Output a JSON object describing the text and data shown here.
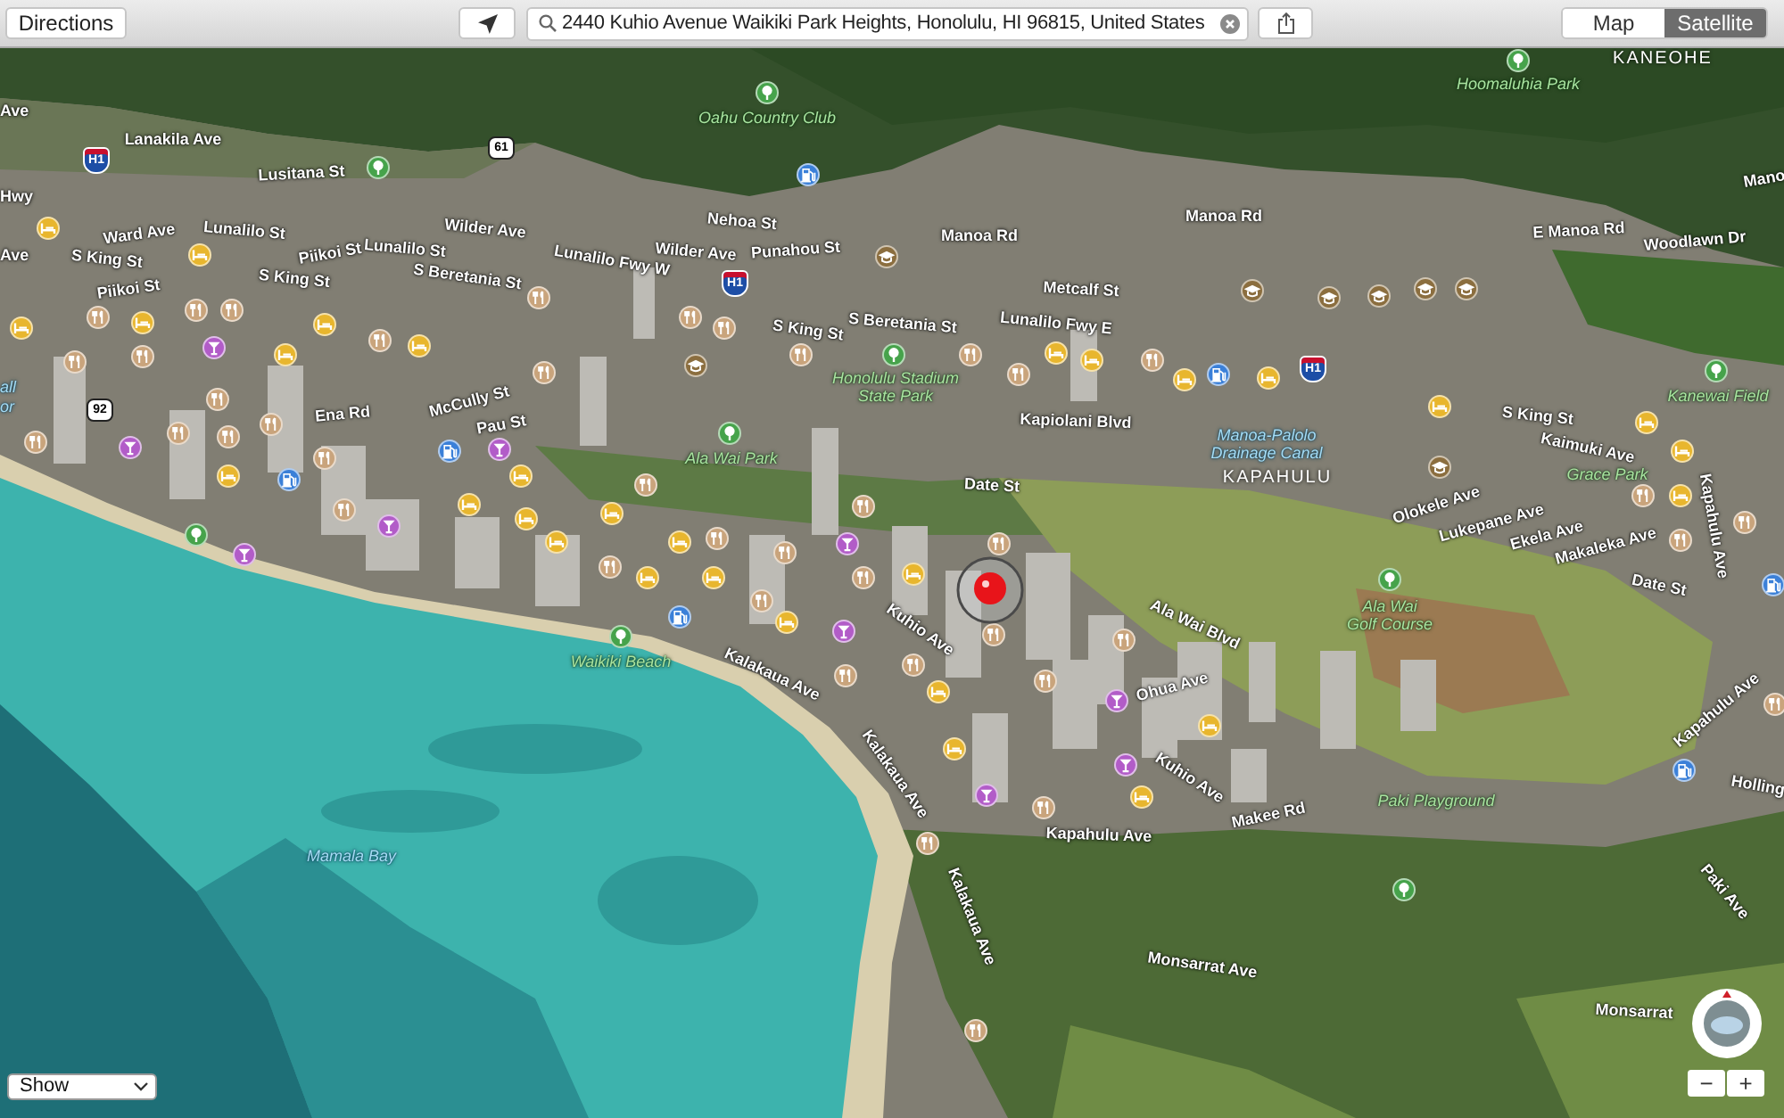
{
  "toolbar": {
    "directions_button": "Directions",
    "search": {
      "value": "2440 Kuhio Avenue Waikiki Park Heights, Honolulu, HI 96815, United States"
    },
    "view_modes": [
      {
        "label": "Map",
        "selected": false
      },
      {
        "label": "Satellite",
        "selected": true
      }
    ]
  },
  "map": {
    "labels": [
      {
        "kind": "district",
        "text": "KANEOHE"
      },
      {
        "kind": "park",
        "text": "Hoomaluhia Park"
      },
      {
        "kind": "street",
        "text": "Ave"
      },
      {
        "kind": "park",
        "text": "Oahu Country Club"
      },
      {
        "kind": "street",
        "text": "Lanakila Ave"
      },
      {
        "kind": "street",
        "text": "Lusitana St"
      },
      {
        "kind": "street",
        "text": "Mano"
      },
      {
        "kind": "street",
        "text": "Hwy"
      },
      {
        "kind": "street",
        "text": "Manoa Rd"
      },
      {
        "kind": "street",
        "text": "Nehoa St"
      },
      {
        "kind": "street",
        "text": "Ward Ave"
      },
      {
        "kind": "street",
        "text": "Lunalilo St"
      },
      {
        "kind": "street",
        "text": "Wilder Ave"
      },
      {
        "kind": "street",
        "text": "E Manoa Rd"
      },
      {
        "kind": "street",
        "text": "Manoa Rd"
      },
      {
        "kind": "street",
        "text": "Woodlawn Dr"
      },
      {
        "kind": "street",
        "text": "Lunalilo St"
      },
      {
        "kind": "street",
        "text": "Punahou St"
      },
      {
        "kind": "street",
        "text": "Wilder Ave"
      },
      {
        "kind": "street",
        "text": "Ave"
      },
      {
        "kind": "street",
        "text": "Piikoi St"
      },
      {
        "kind": "street",
        "text": "S King St"
      },
      {
        "kind": "street",
        "text": "Lunalilo Fwy W"
      },
      {
        "kind": "street",
        "text": "S King St"
      },
      {
        "kind": "street",
        "text": "S Beretania St"
      },
      {
        "kind": "street",
        "text": "Metcalf St"
      },
      {
        "kind": "street",
        "text": "Piikoi St"
      },
      {
        "kind": "street",
        "text": "S King St"
      },
      {
        "kind": "street",
        "text": "S Beretania St"
      },
      {
        "kind": "street",
        "text": "Lunalilo Fwy E"
      },
      {
        "kind": "water",
        "text": "all"
      },
      {
        "kind": "water",
        "text": "or"
      },
      {
        "kind": "street",
        "text": "Ena Rd"
      },
      {
        "kind": "street",
        "text": "McCully St"
      },
      {
        "kind": "street",
        "text": "Pau St"
      },
      {
        "kind": "park",
        "text": "Honolulu Stadium\nState Park"
      },
      {
        "kind": "street",
        "text": "Kapiolani Blvd"
      },
      {
        "kind": "street",
        "text": "S King St"
      },
      {
        "kind": "park",
        "text": "Kanewai Field"
      },
      {
        "kind": "park",
        "text": "Ala Wai Park"
      },
      {
        "kind": "water",
        "text": "Manoa-Palolo\nDrainage Canal"
      },
      {
        "kind": "street",
        "text": "Kaimuki Ave"
      },
      {
        "kind": "street",
        "text": "Date St"
      },
      {
        "kind": "district",
        "text": "KAPAHULU"
      },
      {
        "kind": "park",
        "text": "Grace Park"
      },
      {
        "kind": "street",
        "text": "Olokele Ave"
      },
      {
        "kind": "street",
        "text": "Lukepane Ave"
      },
      {
        "kind": "street",
        "text": "Ekela Ave"
      },
      {
        "kind": "street",
        "text": "Makaleka Ave"
      },
      {
        "kind": "street",
        "text": "Date St"
      },
      {
        "kind": "street",
        "text": "Kapahulu Ave"
      },
      {
        "kind": "park",
        "text": "Waikiki Beach"
      },
      {
        "kind": "street",
        "text": "Kalakaua Ave"
      },
      {
        "kind": "street",
        "text": "Kuhio Ave"
      },
      {
        "kind": "street",
        "text": "Ohua Ave"
      },
      {
        "kind": "street",
        "text": "Ala Wai Blvd"
      },
      {
        "kind": "park",
        "text": "Ala Wai\nGolf Course"
      },
      {
        "kind": "street",
        "text": "Kapahulu Ave"
      },
      {
        "kind": "street",
        "text": "Kalakaua Ave"
      },
      {
        "kind": "street",
        "text": "Kapahulu Ave"
      },
      {
        "kind": "street",
        "text": "Kuhio Ave"
      },
      {
        "kind": "street",
        "text": "Makee Rd"
      },
      {
        "kind": "park",
        "text": "Paki Playground"
      },
      {
        "kind": "street",
        "text": "Holling"
      },
      {
        "kind": "water",
        "text": "Mamala Bay"
      },
      {
        "kind": "street",
        "text": "Kalakaua Ave"
      },
      {
        "kind": "street",
        "text": "Paki Ave"
      },
      {
        "kind": "street",
        "text": "Monsarrat Ave"
      },
      {
        "kind": "street",
        "text": "Monsarrat"
      }
    ],
    "route_shields": [
      {
        "kind": "interstate",
        "label": "H1"
      },
      {
        "kind": "state",
        "label": "61"
      },
      {
        "kind": "state",
        "label": "92"
      },
      {
        "kind": "interstate",
        "label": "H1"
      },
      {
        "kind": "interstate",
        "label": "H1"
      }
    ],
    "markers": [
      {
        "kind": "park",
        "color": "#46a34b"
      },
      {
        "kind": "park",
        "color": "#46a34b"
      },
      {
        "kind": "park",
        "color": "#46a34b"
      },
      {
        "kind": "fuel",
        "color": "#3b80d8"
      },
      {
        "kind": "hotel",
        "color": "#e8b62e"
      },
      {
        "kind": "hotel",
        "color": "#e8b62e"
      },
      {
        "kind": "school",
        "color": "#8b6e3f"
      },
      {
        "kind": "school",
        "color": "#8b6e3f"
      },
      {
        "kind": "school",
        "color": "#8b6e3f"
      },
      {
        "kind": "school",
        "color": "#8b6e3f"
      },
      {
        "kind": "school",
        "color": "#8b6e3f"
      },
      {
        "kind": "school",
        "color": "#8b6e3f"
      },
      {
        "kind": "restaurant",
        "color": "#c9a47c"
      },
      {
        "kind": "restaurant",
        "color": "#c9a47c"
      },
      {
        "kind": "restaurant",
        "color": "#c9a47c"
      },
      {
        "kind": "restaurant",
        "color": "#c9a47c"
      },
      {
        "kind": "restaurant",
        "color": "#c9a47c"
      },
      {
        "kind": "hotel",
        "color": "#e8b62e"
      },
      {
        "kind": "hotel",
        "color": "#e8b62e"
      },
      {
        "kind": "hotel",
        "color": "#e8b62e"
      },
      {
        "kind": "restaurant",
        "color": "#c9a47c"
      },
      {
        "kind": "nightlife",
        "color": "#b25cc8"
      },
      {
        "kind": "restaurant",
        "color": "#c9a47c"
      },
      {
        "kind": "hotel",
        "color": "#e8b62e"
      },
      {
        "kind": "hotel",
        "color": "#e8b62e"
      },
      {
        "kind": "restaurant",
        "color": "#c9a47c"
      },
      {
        "kind": "park",
        "color": "#46a34b"
      },
      {
        "kind": "restaurant",
        "color": "#c9a47c"
      },
      {
        "kind": "hotel",
        "color": "#e8b62e"
      },
      {
        "kind": "restaurant",
        "color": "#c9a47c"
      },
      {
        "kind": "restaurant",
        "color": "#c9a47c"
      },
      {
        "kind": "hotel",
        "color": "#e8b62e"
      },
      {
        "kind": "restaurant",
        "color": "#c9a47c"
      },
      {
        "kind": "school",
        "color": "#8b6e3f"
      },
      {
        "kind": "restaurant",
        "color": "#c9a47c"
      },
      {
        "kind": "park",
        "color": "#46a34b"
      },
      {
        "kind": "fuel",
        "color": "#3b80d8"
      },
      {
        "kind": "restaurant",
        "color": "#c9a47c"
      },
      {
        "kind": "hotel",
        "color": "#e8b62e"
      },
      {
        "kind": "hotel",
        "color": "#e8b62e"
      },
      {
        "kind": "restaurant",
        "color": "#c9a47c"
      },
      {
        "kind": "hotel",
        "color": "#e8b62e"
      },
      {
        "kind": "restaurant",
        "color": "#c9a47c"
      },
      {
        "kind": "hotel",
        "color": "#e8b62e"
      },
      {
        "kind": "restaurant",
        "color": "#c9a47c"
      },
      {
        "kind": "park",
        "color": "#46a34b"
      },
      {
        "kind": "restaurant",
        "color": "#c9a47c"
      },
      {
        "kind": "restaurant",
        "color": "#c9a47c"
      },
      {
        "kind": "nightlife",
        "color": "#b25cc8"
      },
      {
        "kind": "nightlife",
        "color": "#b25cc8"
      },
      {
        "kind": "fuel",
        "color": "#3b80d8"
      },
      {
        "kind": "hotel",
        "color": "#e8b62e"
      },
      {
        "kind": "restaurant",
        "color": "#c9a47c"
      },
      {
        "kind": "school",
        "color": "#8b6e3f"
      },
      {
        "kind": "hotel",
        "color": "#e8b62e"
      },
      {
        "kind": "hotel",
        "color": "#e8b62e"
      },
      {
        "kind": "fuel",
        "color": "#3b80d8"
      },
      {
        "kind": "restaurant",
        "color": "#c9a47c"
      },
      {
        "kind": "restaurant",
        "color": "#c9a47c"
      },
      {
        "kind": "hotel",
        "color": "#e8b62e"
      },
      {
        "kind": "hotel",
        "color": "#e8b62e"
      },
      {
        "kind": "restaurant",
        "color": "#c9a47c"
      },
      {
        "kind": "restaurant",
        "color": "#c9a47c"
      },
      {
        "kind": "hotel",
        "color": "#e8b62e"
      },
      {
        "kind": "hotel",
        "color": "#e8b62e"
      },
      {
        "kind": "restaurant",
        "color": "#c9a47c"
      },
      {
        "kind": "nightlife",
        "color": "#b25cc8"
      },
      {
        "kind": "park",
        "color": "#46a34b"
      },
      {
        "kind": "hotel",
        "color": "#e8b62e"
      },
      {
        "kind": "restaurant",
        "color": "#c9a47c"
      },
      {
        "kind": "restaurant",
        "color": "#c9a47c"
      },
      {
        "kind": "hotel",
        "color": "#e8b62e"
      },
      {
        "kind": "nightlife",
        "color": "#b25cc8"
      },
      {
        "kind": "restaurant",
        "color": "#c9a47c"
      },
      {
        "kind": "nightlife",
        "color": "#b25cc8"
      },
      {
        "kind": "restaurant",
        "color": "#c9a47c"
      },
      {
        "kind": "restaurant",
        "color": "#c9a47c"
      },
      {
        "kind": "hotel",
        "color": "#e8b62e"
      },
      {
        "kind": "restaurant",
        "color": "#c9a47c"
      },
      {
        "kind": "hotel",
        "color": "#e8b62e"
      },
      {
        "kind": "hotel",
        "color": "#e8b62e"
      },
      {
        "kind": "park",
        "color": "#46a34b"
      },
      {
        "kind": "fuel",
        "color": "#3b80d8"
      },
      {
        "kind": "restaurant",
        "color": "#c9a47c"
      },
      {
        "kind": "fuel",
        "color": "#3b80d8"
      },
      {
        "kind": "restaurant",
        "color": "#c9a47c"
      },
      {
        "kind": "nightlife",
        "color": "#b25cc8"
      },
      {
        "kind": "park",
        "color": "#46a34b"
      },
      {
        "kind": "hotel",
        "color": "#e8b62e"
      },
      {
        "kind": "restaurant",
        "color": "#c9a47c"
      },
      {
        "kind": "restaurant",
        "color": "#c9a47c"
      },
      {
        "kind": "restaurant",
        "color": "#c9a47c"
      },
      {
        "kind": "restaurant",
        "color": "#c9a47c"
      },
      {
        "kind": "hotel",
        "color": "#e8b62e"
      },
      {
        "kind": "nightlife",
        "color": "#b25cc8"
      },
      {
        "kind": "restaurant",
        "color": "#c9a47c"
      },
      {
        "kind": "hotel",
        "color": "#e8b62e"
      },
      {
        "kind": "hotel",
        "color": "#e8b62e"
      },
      {
        "kind": "nightlife",
        "color": "#b25cc8"
      },
      {
        "kind": "fuel",
        "color": "#3b80d8"
      },
      {
        "kind": "nightlife",
        "color": "#b25cc8"
      },
      {
        "kind": "hotel",
        "color": "#e8b62e"
      },
      {
        "kind": "restaurant",
        "color": "#c9a47c"
      },
      {
        "kind": "restaurant",
        "color": "#c9a47c"
      },
      {
        "kind": "park",
        "color": "#46a34b"
      },
      {
        "kind": "restaurant",
        "color": "#c9a47c"
      }
    ]
  },
  "controls": {
    "show_menu": "Show",
    "zoom_buttons": [
      "−",
      "+"
    ]
  }
}
